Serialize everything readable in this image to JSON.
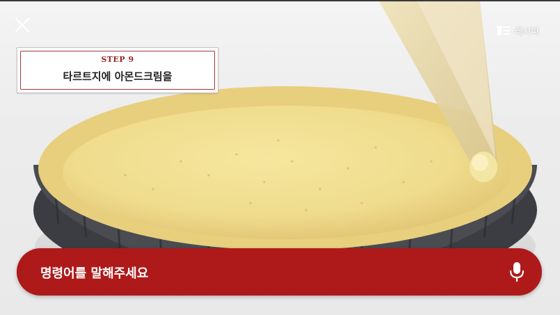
{
  "header": {
    "close_icon": "close-icon",
    "recipe_icon": "recipe-list-icon",
    "recipe_label": "레시피"
  },
  "step": {
    "number_label": "STEP 9",
    "title": "타르트지에 아몬드크림을"
  },
  "voice": {
    "prompt": "명령어를 말해주세요",
    "mic_icon": "microphone-icon"
  },
  "colors": {
    "accent_red": "#ae1a1a",
    "step_red": "#a32020",
    "dough": "#eed98a"
  }
}
